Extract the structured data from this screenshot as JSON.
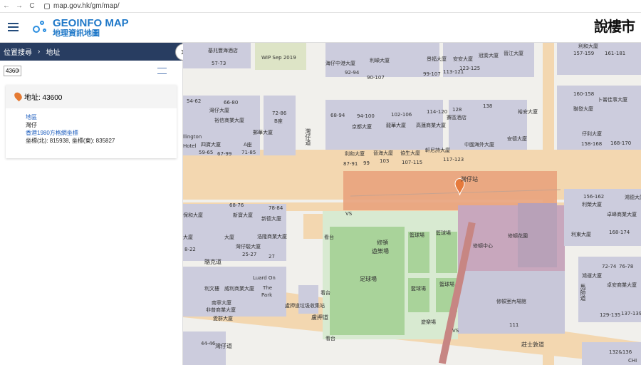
{
  "browser": {
    "url": "map.gov.hk/gm/map/",
    "back": "←",
    "forward": "→",
    "reload": "C"
  },
  "header": {
    "logo_en": "GEOINFO MAP",
    "logo_zh": "地理資訊地圖",
    "brand": "說樓市"
  },
  "panel": {
    "location_tab": "位置搜尋",
    "separator": "›",
    "address_tab": "地址",
    "search_value": "43600",
    "result_title": "地址: 43600",
    "result_type": "地區",
    "result_area": "灣仔",
    "coord_system": "香港1980方格網坐標",
    "coords": "坐標(北): 815938, 坐標(東): 835827"
  },
  "map": {
    "labels": {
      "l1": "基兆豐海酒店",
      "l2": "WIP Sep 2019",
      "l3": "海仔中港大廈",
      "l4": "利嶸大廈",
      "l5": "景福大廈",
      "l6": "安安大廈",
      "l7": "冠奏大廈",
      "l8": "晉江大廈",
      "l9": "57-73",
      "l10": "90-107",
      "l11": "113-121",
      "l12": "123-125",
      "l13": "99-107",
      "l14": "92-94",
      "l15": "54-62",
      "l16": "灣仔大廈",
      "l17": "66-80",
      "l18": "裕信商業大廈",
      "l19": "72-86",
      "l20": "B座",
      "l21": "郵華大廈",
      "l22": "68-94",
      "l23": "94-100",
      "l24": "102-106",
      "l25": "114-120",
      "l26": "128",
      "l27": "賽區酒店",
      "l28": "138",
      "l29": "160-158",
      "l30": "卜崙佳事大廈",
      "l31": "利和大廈",
      "l32": "157-159",
      "l33": "161-181",
      "l34": "京都大廈",
      "l35": "龍華大廈",
      "l36": "高蓮商業大廈",
      "l37": "裕安大廈",
      "l38": "安德大廈",
      "l39": "仔利大廈",
      "l40": "聯發大廈",
      "l41": "llington",
      "l42": "Hotel",
      "l43": "四寶大廈",
      "l44": "A座",
      "l45": "59-65",
      "l46": "67-99",
      "l47": "71-85",
      "l48": "利和大廈",
      "l49": "晉海大廈",
      "l50": "協生大廈",
      "l51": "軒尼詩大廈",
      "l52": "中國海外大廈",
      "l53": "87-91",
      "l54": "99",
      "l55": "103",
      "l56": "107-115",
      "l57": "117-123",
      "l58": "158-168",
      "l59": "168-170",
      "l60": "灣仔站",
      "l61": "灣仔道",
      "l62": "68-76",
      "l63": "78-84",
      "l64": "新寶大廈",
      "l65": "新德大廈",
      "l66": "保和大廈",
      "l67": "浩隆商業大廈",
      "l68": "修頓",
      "l69": "遊樂場",
      "l70": "籃球場",
      "l71": "籃球場",
      "l72": "修頓中心",
      "l73": "修頓花園",
      "l74": "大廈",
      "l75": "大廈",
      "l76": "8-22",
      "l77": "25-27",
      "l78": "27",
      "l79": "灣仔駿大廈",
      "l80": "利東大廈",
      "l81": "156-162",
      "l82": "利榮大廈",
      "l83": "168-174",
      "l84": "卓峰商業大廈",
      "l85": "鴻德大廈",
      "l86": "駱克道",
      "l87": "足球場",
      "l88": "籃球場",
      "l89": "籃球場",
      "l90": "修頓室內場館",
      "l91": "72-74",
      "l92": "76-78",
      "l93": "鴻運大廈",
      "l94": "卓安商業大廈",
      "l95": "129-135",
      "l96": "137-139",
      "l97": "利文樓",
      "l98": "威利商業大廈",
      "l99": "The",
      "l100": "Park",
      "l101": "南寧大廈",
      "l102": "非普商業大廈",
      "l103": "愛群大廈",
      "l104": "Luard On",
      "l105": "盧押道垃圾收集站",
      "l106": "看台",
      "l107": "看台",
      "l108": "遊樂場",
      "l109": "VS",
      "l110": "VS",
      "l111": "莊士敦道",
      "l112": "111",
      "l113": "132&136",
      "l114": "CHI",
      "l115": "44-46",
      "l116": "灣仔道",
      "l117": "馬師道",
      "l118": "盧押道",
      "l119": "看台"
    }
  }
}
